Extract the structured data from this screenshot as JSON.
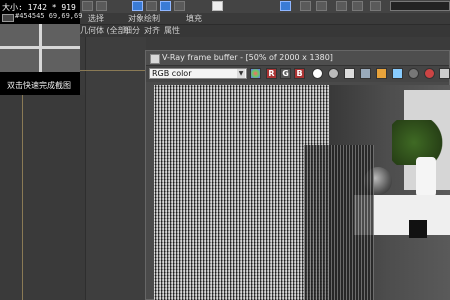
{
  "capture": {
    "size_text": "大小: 1742 * 919",
    "color_text": "#454545  69,69,69",
    "hint": "双击快速完成截图",
    "swatch_color": "#454545"
  },
  "menu": {
    "items": [
      "选择",
      "对象绘制",
      "填充"
    ],
    "second_row": [
      "几何体 (全部)",
      "细分",
      "对齐",
      "属性"
    ]
  },
  "vfb": {
    "title": "V-Ray frame buffer - [50% of 2000 x 1380]",
    "channel": "RGB color",
    "channel_buttons": [
      "R",
      "G",
      "B"
    ]
  }
}
